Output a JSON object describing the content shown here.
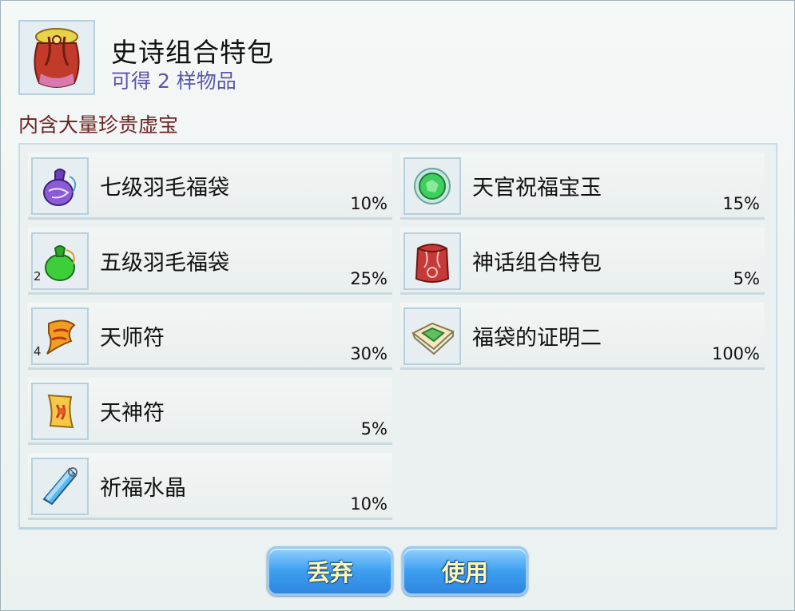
{
  "package": {
    "title": "史诗组合特包",
    "subtitle": "可得 2 样物品",
    "description": "内含大量珍贵虚宝",
    "icon": "red-gold-sack-icon"
  },
  "items": [
    {
      "name": "七级羽毛福袋",
      "chance": "10%",
      "qty": "",
      "icon": "purple-pouch-icon"
    },
    {
      "name": "天官祝福宝玉",
      "chance": "15%",
      "qty": "",
      "icon": "green-jade-orb-icon"
    },
    {
      "name": "五级羽毛福袋",
      "chance": "25%",
      "qty": "2",
      "icon": "green-pouch-icon"
    },
    {
      "name": "神话组合特包",
      "chance": "5%",
      "qty": "",
      "icon": "red-sack-icon"
    },
    {
      "name": "天师符",
      "chance": "30%",
      "qty": "4",
      "icon": "orange-talisman-icon"
    },
    {
      "name": "福袋的证明二",
      "chance": "100%",
      "qty": "",
      "icon": "green-certificate-icon"
    },
    {
      "name": "天神符",
      "chance": "5%",
      "qty": "",
      "icon": "red-scroll-icon"
    },
    {
      "name": "祈福水晶",
      "chance": "10%",
      "qty": "",
      "icon": "blue-crystal-icon"
    }
  ],
  "buttons": {
    "discard": "丢弃",
    "use": "使用"
  },
  "colors": {
    "subtitle": "#5b58a8",
    "description": "#6b2323",
    "button": "#3d9ff0",
    "button_text": "#fff8b0"
  }
}
